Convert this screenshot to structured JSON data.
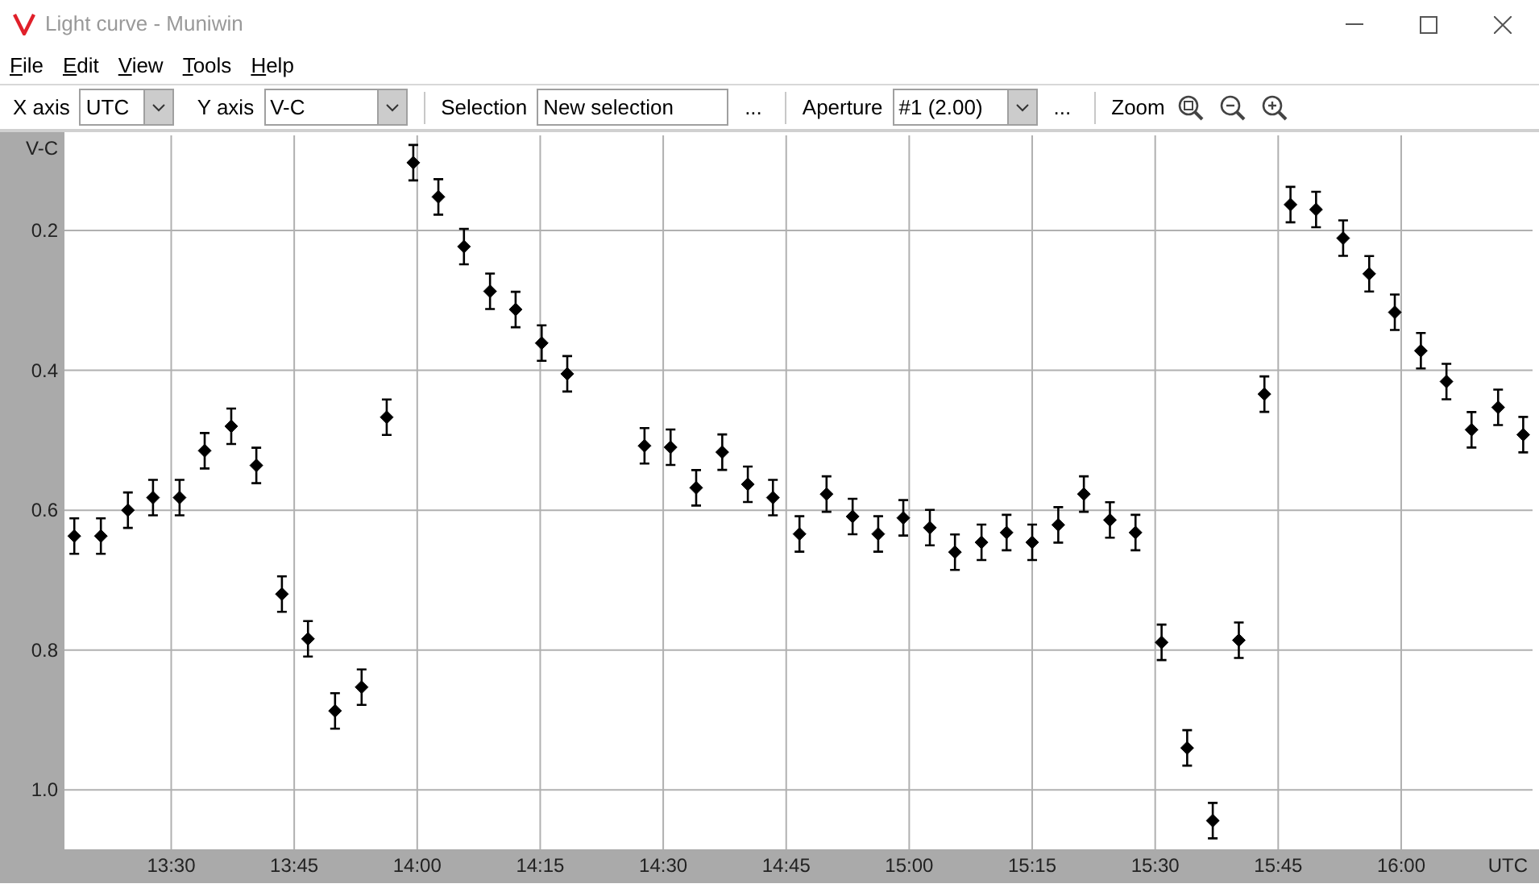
{
  "window": {
    "title": "Light curve - Muniwin"
  },
  "menu": [
    "File",
    "Edit",
    "View",
    "Tools",
    "Help"
  ],
  "toolbar": {
    "x_axis": {
      "label": "X axis",
      "value": "UTC"
    },
    "y_axis": {
      "label": "Y axis",
      "value": "V-C"
    },
    "selection": {
      "label": "Selection",
      "value": "New selection",
      "more": "..."
    },
    "aperture": {
      "label": "Aperture",
      "value": "#1 (2.00)",
      "more": "..."
    },
    "zoom": {
      "label": "Zoom"
    }
  },
  "chart_data": {
    "type": "scatter",
    "grid": true,
    "xlabel": "UTC",
    "ylabel": "V-C",
    "xlim": [
      13.283,
      16.267
    ],
    "ylim": [
      1.085,
      0.064
    ],
    "xticks": [
      {
        "value": 13.5,
        "label": "13:30"
      },
      {
        "value": 13.75,
        "label": "13:45"
      },
      {
        "value": 14.0,
        "label": "14:00"
      },
      {
        "value": 14.25,
        "label": "14:15"
      },
      {
        "value": 14.5,
        "label": "14:30"
      },
      {
        "value": 14.75,
        "label": "14:45"
      },
      {
        "value": 15.0,
        "label": "15:00"
      },
      {
        "value": 15.25,
        "label": "15:15"
      },
      {
        "value": 15.5,
        "label": "15:30"
      },
      {
        "value": 15.75,
        "label": "15:45"
      },
      {
        "value": 16.0,
        "label": "16:00"
      }
    ],
    "yticks": [
      {
        "value": 0.2,
        "label": "0.2"
      },
      {
        "value": 0.4,
        "label": "0.4"
      },
      {
        "value": 0.6,
        "label": "0.6"
      },
      {
        "value": 0.8,
        "label": "0.8"
      },
      {
        "value": 1.0,
        "label": "1.0"
      }
    ],
    "x": [
      13.303,
      13.357,
      13.412,
      13.463,
      13.517,
      13.568,
      13.622,
      13.673,
      13.725,
      13.778,
      13.833,
      13.887,
      13.938,
      13.992,
      14.043,
      14.095,
      14.148,
      14.2,
      14.253,
      14.305,
      14.462,
      14.515,
      14.567,
      14.62,
      14.672,
      14.723,
      14.777,
      14.832,
      14.885,
      14.937,
      14.988,
      15.042,
      15.093,
      15.147,
      15.198,
      15.25,
      15.303,
      15.355,
      15.408,
      15.46,
      15.513,
      15.565,
      15.617,
      15.67,
      15.722,
      15.775,
      15.827,
      15.882,
      15.935,
      15.987,
      16.04,
      16.092,
      16.143,
      16.197,
      16.248
    ],
    "series": [
      {
        "color": "#000000",
        "values": [
          0.637,
          0.637,
          0.6,
          0.582,
          0.582,
          0.515,
          0.48,
          0.536,
          0.72,
          0.784,
          0.887,
          0.853,
          0.467,
          0.103,
          0.152,
          0.223,
          0.287,
          0.313,
          0.361,
          0.405,
          0.508,
          0.51,
          0.568,
          0.517,
          0.563,
          0.582,
          0.634,
          0.577,
          0.609,
          0.634,
          0.611,
          0.625,
          0.66,
          0.646,
          0.632,
          0.646,
          0.621,
          0.577,
          0.614,
          0.632,
          0.789,
          0.94,
          1.044,
          0.786,
          0.434,
          0.163,
          0.17,
          0.211,
          0.262,
          0.317,
          0.372,
          0.416,
          0.485,
          0.453,
          0.492
        ]
      }
    ]
  }
}
